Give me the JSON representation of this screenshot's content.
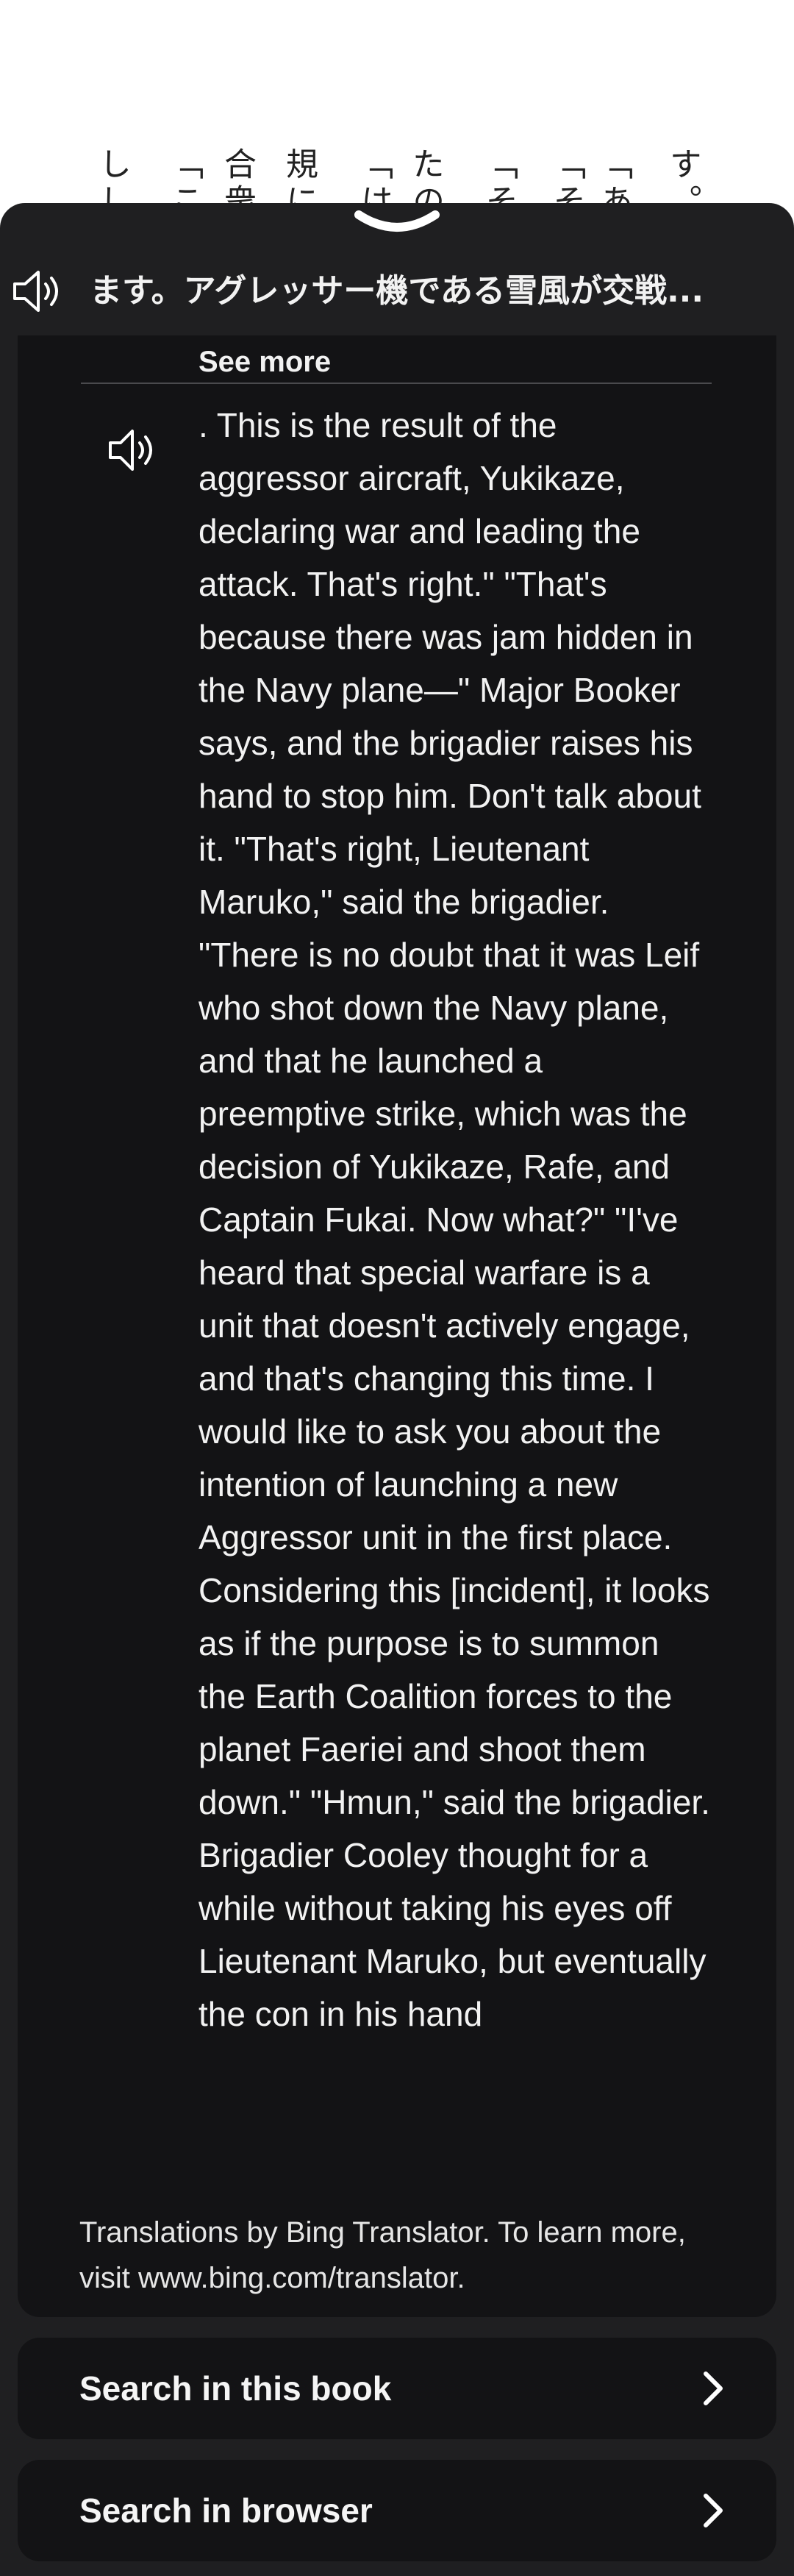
{
  "background_page": {
    "columns": [
      "す。",
      "「あ",
      "「そ",
      "「そ",
      "たの",
      "「は",
      "規に",
      "合衆",
      "「こ",
      "しし"
    ]
  },
  "popup": {
    "selected_text": "ます。アグレッサー機である雪風が交戦...",
    "see_more_label": "See more",
    "translation": ". This is the result of the aggressor aircraft, Yukikaze, declaring war and leading the attack. That's right.\" \"That's because there was jam hidden in the Navy plane—\" Major Booker says, and the brigadier raises his hand to stop him. Don't talk about it. \"That's right, Lieutenant Maruko,\" said the brigadier. \"There is no doubt that it was Leif who shot down the Navy plane, and that he launched a preemptive strike, which was the decision of Yukikaze, Rafe, and Captain Fukai. Now what?\" \"I've heard that special warfare is a unit that doesn't actively engage, and that's changing this time. I would like to ask you about the intention of launching a new Aggressor unit in the first place. Considering this [incident], it looks as if the purpose is to summon the Earth Coalition forces to the planet Faeriei and shoot them down.\" \"Hmun,\" said the brigadier. Brigadier Cooley thought for a while without taking his eyes off Lieutenant Maruko, but eventually the con in his hand",
    "credit": "Translations by Bing Translator. To learn more, visit www.bing.com/translator.",
    "search_book_label": "Search in this book",
    "search_browser_label": "Search in browser"
  },
  "icons": {
    "handle": "chevron-down-icon",
    "speaker": "speaker-icon",
    "chevron": "chevron-right-icon"
  },
  "colors": {
    "sheet": "#1f1f21",
    "card": "#131315",
    "text": "#f2f2f2"
  }
}
